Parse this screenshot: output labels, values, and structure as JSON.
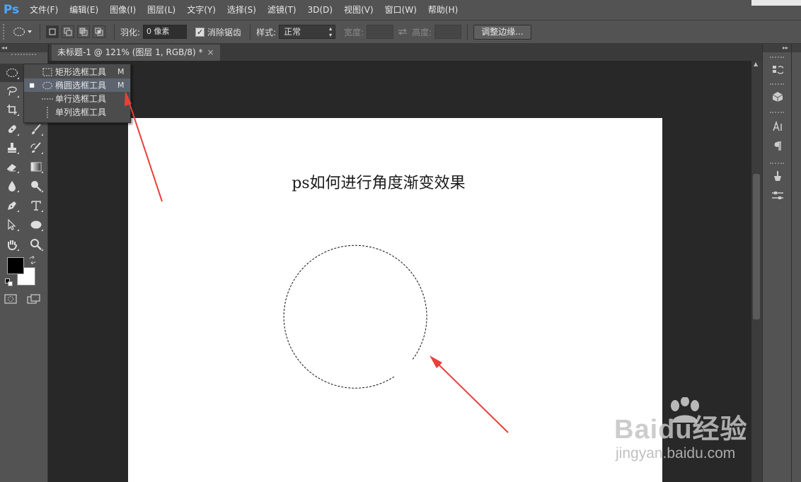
{
  "app": {
    "logo": "Ps"
  },
  "menubar": {
    "items": [
      "文件(F)",
      "编辑(E)",
      "图像(I)",
      "图层(L)",
      "文字(Y)",
      "选择(S)",
      "滤镜(T)",
      "3D(D)",
      "视图(V)",
      "窗口(W)",
      "帮助(H)"
    ]
  },
  "options": {
    "feather_label": "羽化:",
    "feather_value": "0 像素",
    "antialias_label": "消除锯齿",
    "antialias_checked": true,
    "style_label": "样式:",
    "style_value": "正常",
    "width_label": "宽度:",
    "height_label": "高度:",
    "refine_edge_button": "调整边缘..."
  },
  "document": {
    "tab_title": "未标题-1 @ 121% (图层 1, RGB/8) *",
    "tab_close": "×",
    "canvas_text": "ps如何进行角度渐变效果"
  },
  "tool_flyout": {
    "items": [
      {
        "label": "矩形选框工具",
        "shortcut": "M",
        "active": false,
        "icon": "rect-marquee-icon"
      },
      {
        "label": "椭圆选框工具",
        "shortcut": "M",
        "active": true,
        "icon": "elliptical-marquee-icon"
      },
      {
        "label": "单行选框工具",
        "shortcut": "",
        "active": false,
        "icon": "single-row-marquee-icon"
      },
      {
        "label": "单列选框工具",
        "shortcut": "",
        "active": false,
        "icon": "single-column-marquee-icon"
      }
    ]
  },
  "watermark": {
    "logo": "Baidu经验",
    "url": "jingyan.baidu.com"
  },
  "colors": {
    "accent": "#4ea7ff",
    "annotation_arrow": "#e8403a",
    "foreground_swatch": "#000000",
    "background_swatch": "#ffffff"
  }
}
